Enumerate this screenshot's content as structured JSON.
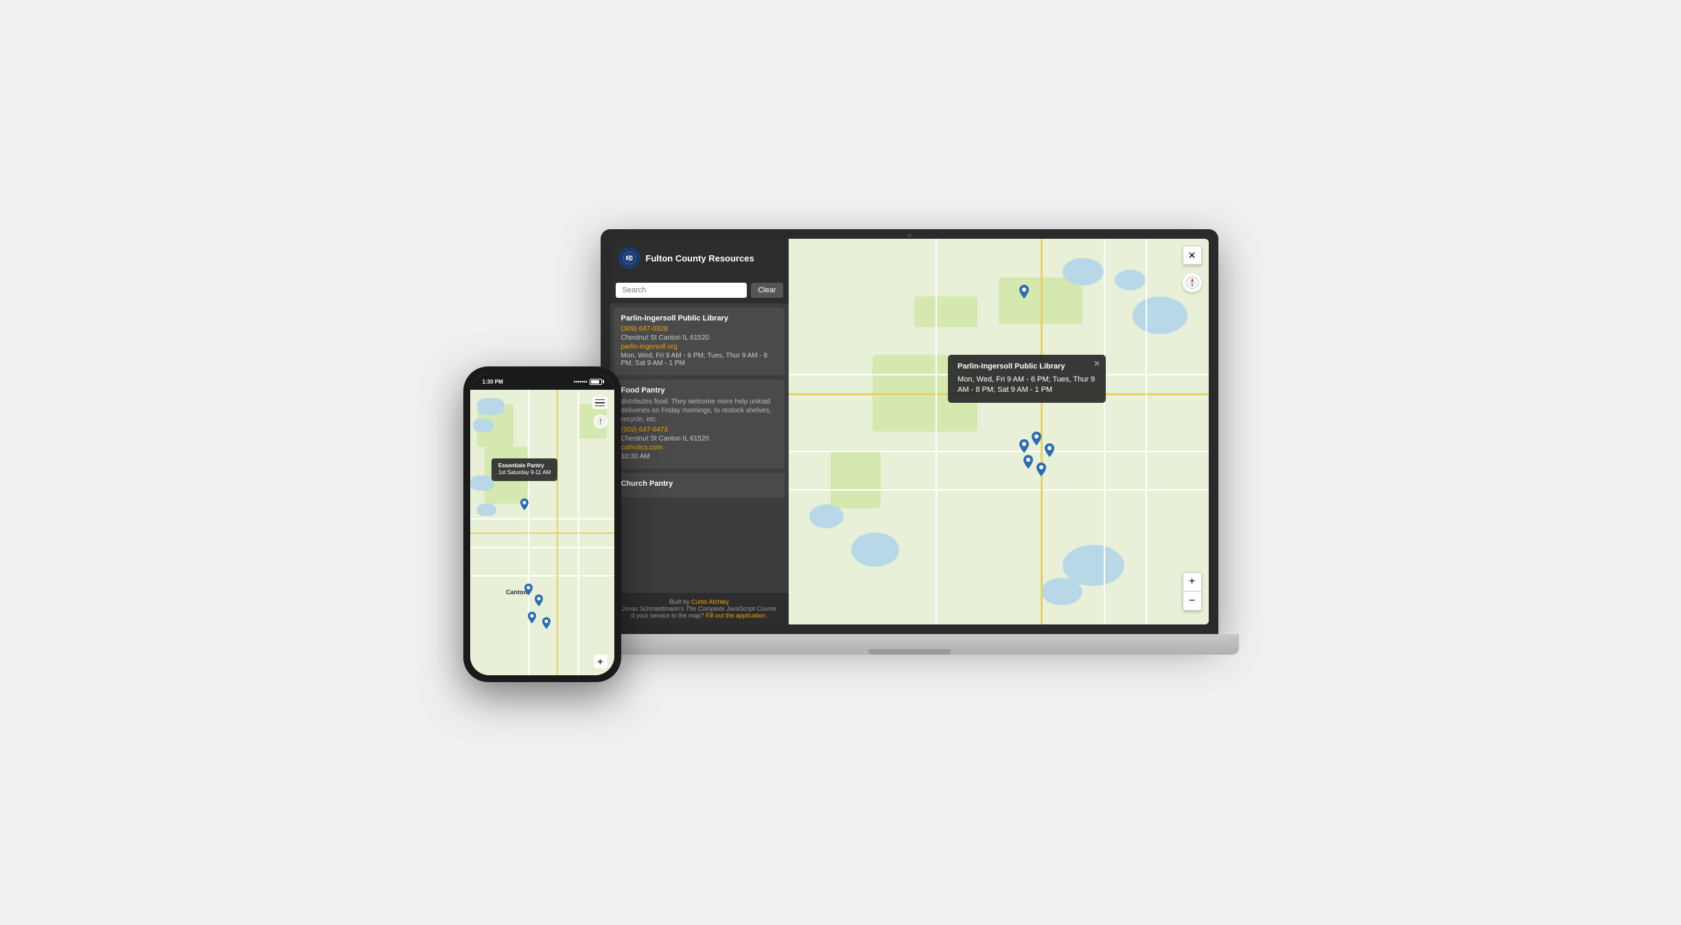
{
  "app": {
    "title": "Fulton County Resources",
    "logo_text": "🔵",
    "search_placeholder": "Search",
    "clear_button": "Clear"
  },
  "resources": [
    {
      "name": "Parlin-Ingersoll Public Library",
      "phone": "(309) 647-0328",
      "address": "Chestnut St Canton IL 61520",
      "website": "parlin-ingersoll.org",
      "hours": "Mon, Wed, Fri 9 AM - 6 PM; Tues, Thur 9 AM - 8 PM; Sat 9 AM - 1 PM",
      "description": ""
    },
    {
      "name": "Food Pantry",
      "phone": "(309) 647-0473",
      "address": "Chestnut St Canton IL 61520",
      "website": "catholics.com",
      "hours": "10:30 AM",
      "description": "distributes food. They welcome more help unload deliveries on Friday mornings, to restock shelves, recycle, etc."
    },
    {
      "name": "Church Pantry",
      "phone": "",
      "address": "",
      "website": "",
      "hours": "",
      "description": ""
    }
  ],
  "footer": {
    "built_by": "Built by",
    "author": "Curtis Atchley",
    "course_prefix": "Jonas Schmedtmann's",
    "course_name": "The Complete JavaScript Course",
    "add_service_text": "d your service to the map?",
    "fill_out": "Fill out the application."
  },
  "map_popup": {
    "title": "Parlin-Ingersoll Public Library",
    "hours": "Mon, Wed, Fri 9 AM - 6 PM; Tues, Thur 9 AM - 8 PM; Sat 9 AM - 1 PM"
  },
  "phone_popup": {
    "title": "Essentials Pantry",
    "hours": "1st Saturday 9-11 AM"
  },
  "map_labels": {
    "canton": "Canton"
  },
  "controls": {
    "close": "✕",
    "zoom_in": "+",
    "zoom_out": "−",
    "compass": "🧭"
  },
  "phone_status": {
    "time": "1:30 PM",
    "battery_dots": "•••••••"
  }
}
